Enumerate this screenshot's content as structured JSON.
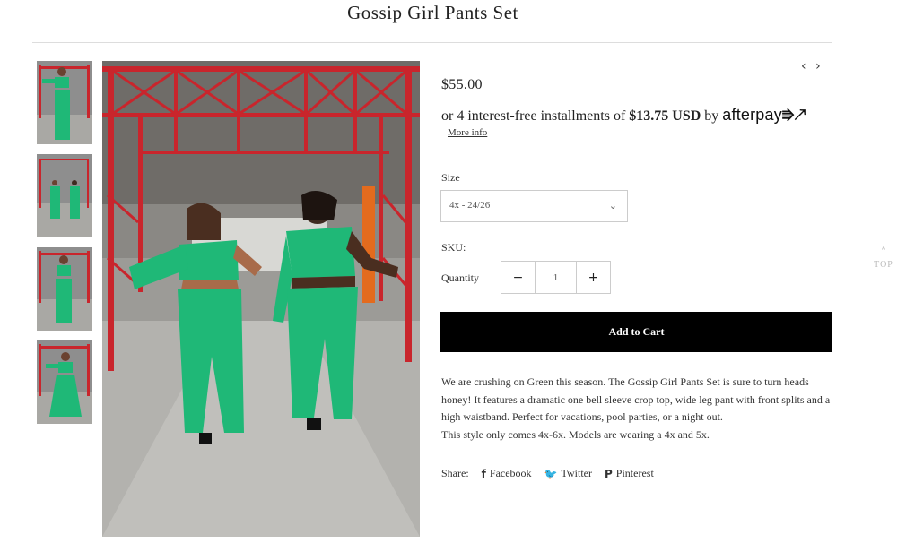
{
  "product": {
    "title": "Gossip Girl Pants Set",
    "price": "$55.00",
    "installments_prefix": "or 4 interest-free installments of",
    "installments_amount": "$13.75 USD",
    "installments_by": "by",
    "afterpay_logo_text": "afterpay",
    "afterpay_mark": "⭆↗",
    "more_info": "More info"
  },
  "nav": {
    "prev_icon": "‹",
    "next_icon": "›"
  },
  "options": {
    "size_label": "Size",
    "size_value": "4x - 24/26",
    "sku_label": "SKU:",
    "quantity_label": "Quantity",
    "quantity_value": "1",
    "minus": "−",
    "plus": "+"
  },
  "cart": {
    "add_label": "Add to Cart"
  },
  "description": {
    "paragraph": "We are crushing on Green this season. The Gossip Girl Pants Set is sure to turn heads honey! It features a dramatic one bell sleeve crop top, wide leg pant with front splits and a high waistband. Perfect for vacations, pool parties, or a night out.",
    "note": "This style only comes 4x-6x. Models are wearing a 4x and 5x."
  },
  "share": {
    "label": "Share:",
    "facebook": "Facebook",
    "twitter": "Twitter",
    "pinterest": "Pinterest",
    "facebook_icon": "f",
    "twitter_icon": "🐦",
    "pinterest_icon": "P"
  },
  "scroll_top": {
    "chevron": "˄",
    "label": "TOP"
  },
  "colors": {
    "outfit_green": "#1fb877",
    "frame_red": "#c9252c",
    "cart_black": "#000000"
  }
}
